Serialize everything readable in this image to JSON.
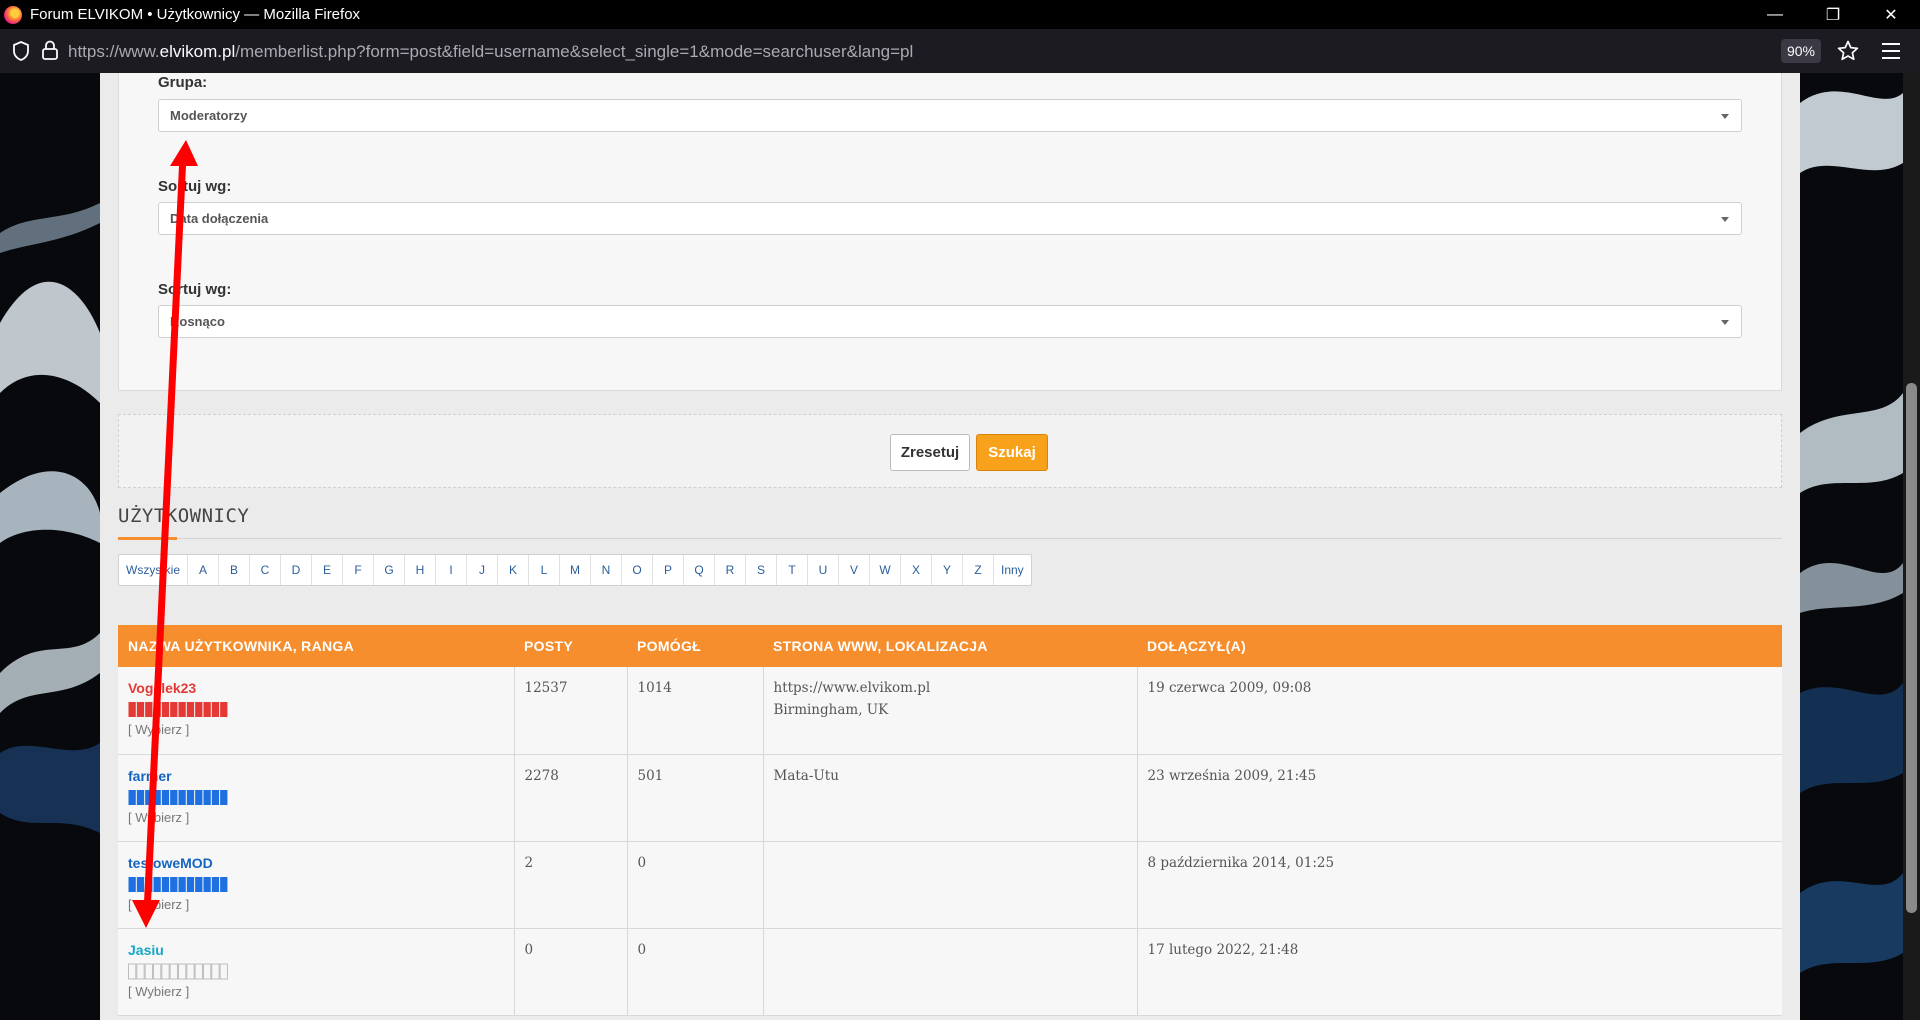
{
  "browser": {
    "window_title": "Forum ELVIKOM • Użytkownicy — Mozilla Firefox",
    "url_prefix": "https://www.",
    "url_host": "elvikom.pl",
    "url_rest": "/memberlist.php?form=post&field=username&select_single=1&mode=searchuser&lang=pl",
    "zoom": "90%",
    "minimize": "—",
    "restore": "❐",
    "close": "✕"
  },
  "form": {
    "group_label": "Grupa:",
    "group_value": "Moderatorzy",
    "sort_label": "Sortuj wg:",
    "sort_value": "Data dołączenia",
    "order_label": "Sortuj wg:",
    "order_value": "Rosnąco"
  },
  "actions": {
    "reset_label": "Zresetuj",
    "search_label": "Szukaj"
  },
  "section": {
    "title": "UŻYTKOWNICY"
  },
  "letters": [
    "Wszystkie",
    "A",
    "B",
    "C",
    "D",
    "E",
    "F",
    "G",
    "H",
    "I",
    "J",
    "K",
    "L",
    "M",
    "N",
    "O",
    "P",
    "Q",
    "R",
    "S",
    "T",
    "U",
    "V",
    "W",
    "X",
    "Y",
    "Z",
    "Inny"
  ],
  "table": {
    "headers": [
      "NAZWA UŻYTKOWNIKA, RANGA",
      "POSTY",
      "POMÓGŁ",
      "STRONA WWW, LOKALIZACJA",
      "DOŁĄCZYŁ(A)"
    ],
    "rows": [
      {
        "username": "Vogelek23",
        "color": "#e53935",
        "rank_color": "#e53935",
        "rank_filled": true,
        "choose": "[ Wybierz ]",
        "posts": "12537",
        "helped": "1014",
        "www": "https://www.elvikom.pl",
        "location": "Birmingham, UK",
        "joined": "19 czerwca 2009, 09:08"
      },
      {
        "username": "farmer",
        "color": "#1565c0",
        "rank_color": "#1e6fe0",
        "rank_filled": true,
        "choose": "[ Wybierz ]",
        "posts": "2278",
        "helped": "501",
        "www": "Mata-Utu",
        "location": "",
        "joined": "23 września 2009, 21:45"
      },
      {
        "username": "testoweMOD",
        "color": "#1565c0",
        "rank_color": "#1e6fe0",
        "rank_filled": true,
        "choose": "[ Wybierz ]",
        "posts": "2",
        "helped": "0",
        "www": "",
        "location": "",
        "joined": "8 października 2014, 01:25"
      },
      {
        "username": "Jasiu",
        "color": "#13a8c9",
        "rank_color": "#bdbdbd",
        "rank_filled": false,
        "choose": "[ Wybierz ]",
        "posts": "0",
        "helped": "0",
        "www": "",
        "location": "",
        "joined": "17 lutego 2022, 21:48"
      }
    ]
  },
  "colors": {
    "accent_orange": "#f78e2e",
    "search_button": "#f8a21c",
    "annotation_arrow": "#ff0000"
  }
}
